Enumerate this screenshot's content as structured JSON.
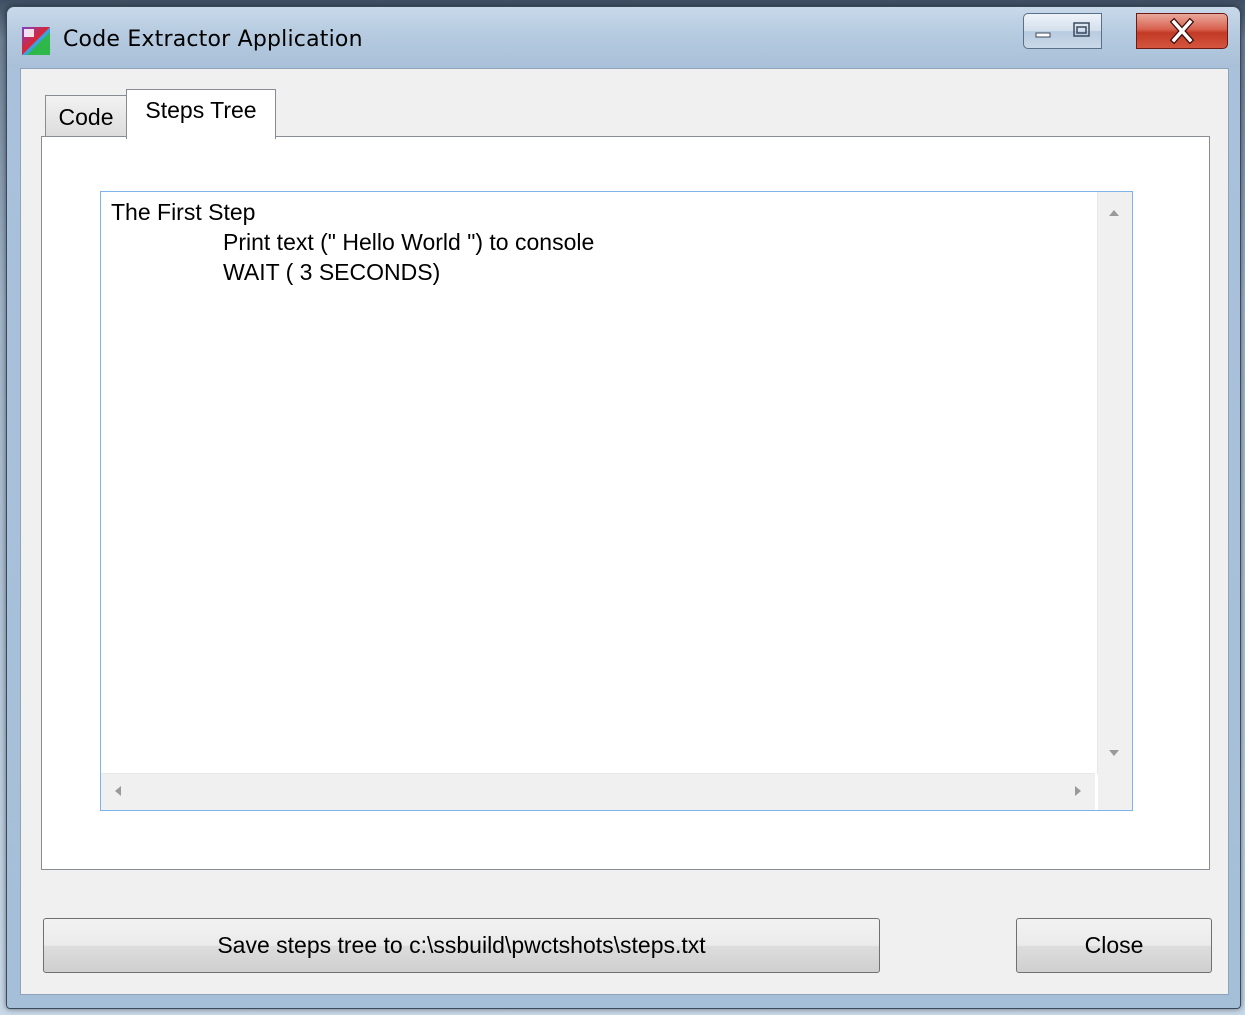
{
  "window": {
    "title": "Code Extractor Application",
    "icon": "app-logo-icon",
    "controls": {
      "minimize": "minimize-icon",
      "maximize": "maximize-icon",
      "close": "close-x-icon"
    }
  },
  "tabs": [
    {
      "label": "Code",
      "selected": false
    },
    {
      "label": "Steps Tree",
      "selected": true
    }
  ],
  "steps_tree": {
    "lines": [
      "The First Step",
      "Print text (\" Hello World \") to console",
      "WAIT ( 3 SECONDS)"
    ]
  },
  "buttons": {
    "save_label": "Save steps tree to c:\\ssbuild\\pwctshots\\steps.txt",
    "close_label": "Close"
  },
  "colors": {
    "title_bar": "#b6cbe0",
    "close_button": "#c23a26",
    "textbox_border": "#7eb4ea",
    "dialog_background": "#f0f0f0"
  }
}
